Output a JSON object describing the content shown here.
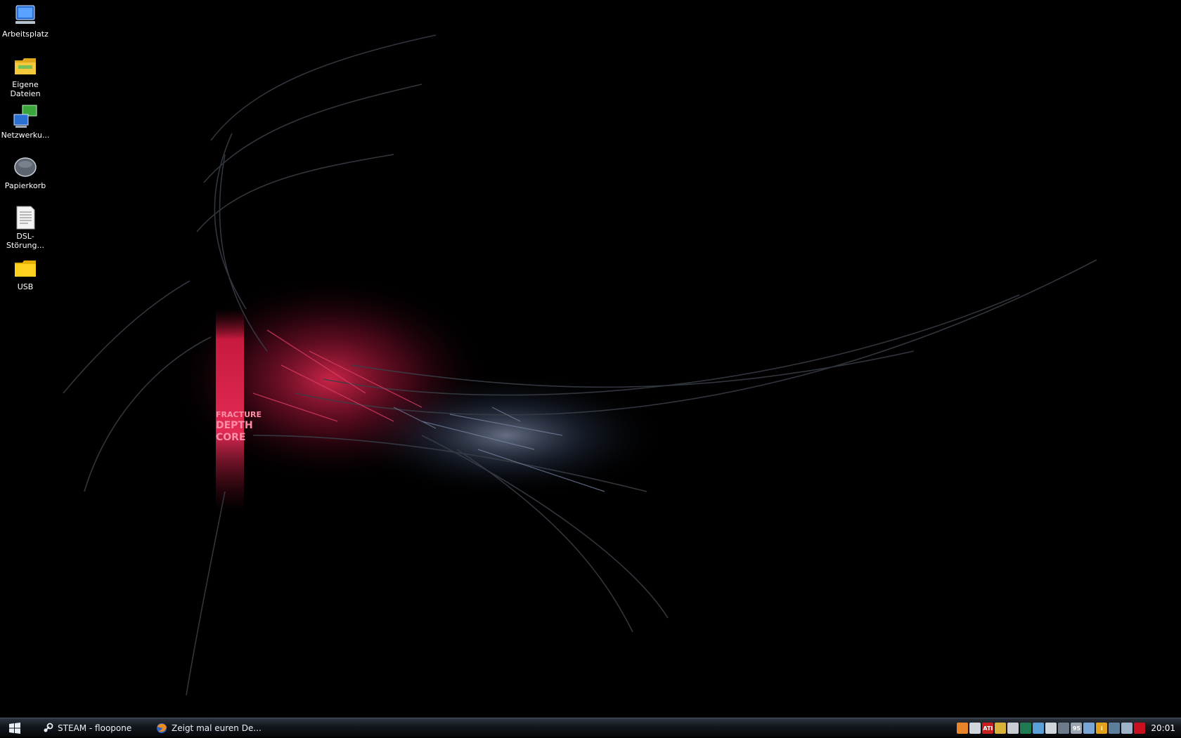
{
  "desktop": {
    "wallpaper_text": [
      "FRACTURE",
      "DEPTH",
      "CORE"
    ],
    "icons": [
      {
        "label": "Arbeitsplatz",
        "icon": "my-computer-icon"
      },
      {
        "label": "Eigene Dateien",
        "icon": "my-documents-folder-icon"
      },
      {
        "label": "Netzwerku...",
        "icon": "network-icon"
      },
      {
        "label": "Papierkorb",
        "icon": "recycle-bin-icon"
      },
      {
        "label": "DSL-Störung...",
        "icon": "text-document-icon"
      },
      {
        "label": "USB",
        "icon": "usb-drive-folder-icon"
      }
    ]
  },
  "taskbar": {
    "start_icon": "windows-logo-icon",
    "tasks": [
      {
        "label": "STEAM - floopone",
        "icon": "steam-icon"
      },
      {
        "label": "Zeigt mal euren De...",
        "icon": "firefox-icon"
      }
    ],
    "tray_icons": [
      "java-icon",
      "steam-tray-icon",
      "ati-icon",
      "gear-sun-icon",
      "volume-icon",
      "network-tray-icon",
      "update-icon",
      "monitor-icon",
      "display-icon",
      "cpu-temp-icon",
      "tool-icon",
      "info-icon",
      "battery-icon",
      "settings-icon",
      "antivirus-icon"
    ],
    "tray_colors": [
      "#e8842a",
      "#cfd5db",
      "#c81e1e",
      "#d9b23a",
      "#c9ccd1",
      "#1f7a52",
      "#5a9fd6",
      "#cfd5db",
      "#6c7a8a",
      "#9aa6b2",
      "#7aa6d6",
      "#e2a21e",
      "#5d7e9b",
      "#9fb3c8",
      "#c8101e"
    ],
    "tray_texts": [
      "",
      "",
      "ATI",
      "",
      "",
      "",
      "",
      "",
      "",
      "95",
      "",
      "i",
      "",
      "",
      ""
    ],
    "clock": "20:01"
  }
}
